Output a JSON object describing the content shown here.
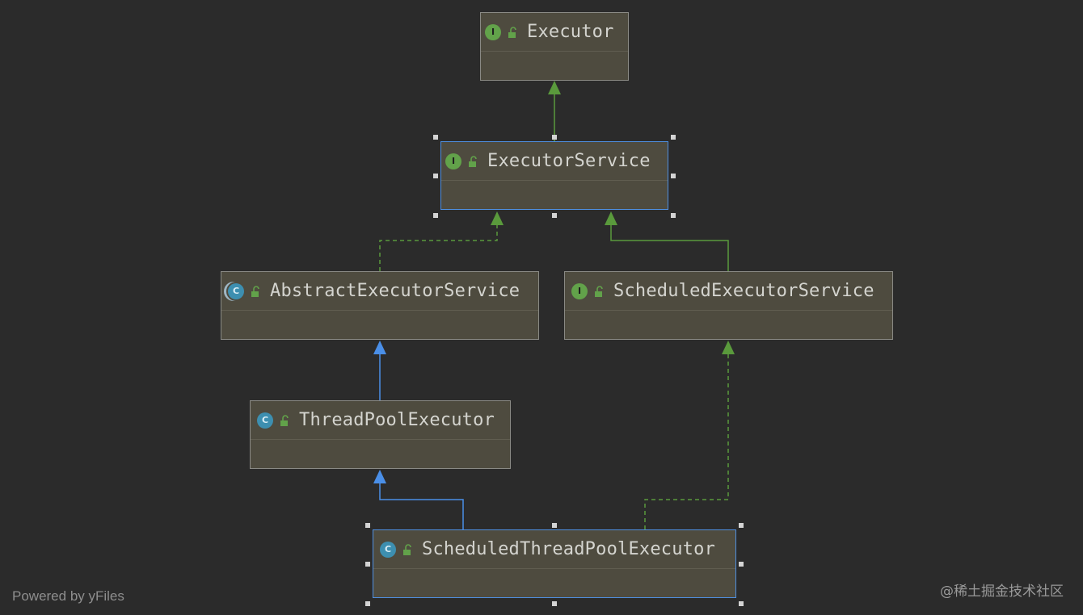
{
  "diagram": {
    "nodes": {
      "executor": {
        "name": "Executor",
        "kind": "interface",
        "badge": "I"
      },
      "executor_service": {
        "name": "ExecutorService",
        "kind": "interface",
        "badge": "I",
        "selected": true
      },
      "abstract_executor_service": {
        "name": "AbstractExecutorService",
        "kind": "abstract class",
        "badge": "C"
      },
      "scheduled_executor_service": {
        "name": "ScheduledExecutorService",
        "kind": "interface",
        "badge": "I"
      },
      "thread_pool_executor": {
        "name": "ThreadPoolExecutor",
        "kind": "class",
        "badge": "C"
      },
      "scheduled_thread_pool_executor": {
        "name": "ScheduledThreadPoolExecutor",
        "kind": "class",
        "badge": "C",
        "selected": true
      }
    },
    "edges": [
      {
        "from": "executor_service",
        "to": "executor",
        "type": "extends",
        "style": "solid",
        "color": "#5a9a3c"
      },
      {
        "from": "abstract_executor_service",
        "to": "executor_service",
        "type": "implements",
        "style": "dashed",
        "color": "#5a9a3c"
      },
      {
        "from": "scheduled_executor_service",
        "to": "executor_service",
        "type": "extends",
        "style": "solid",
        "color": "#5a9a3c"
      },
      {
        "from": "thread_pool_executor",
        "to": "abstract_executor_service",
        "type": "extends",
        "style": "solid",
        "color": "#4a8fe8"
      },
      {
        "from": "scheduled_thread_pool_executor",
        "to": "thread_pool_executor",
        "type": "extends",
        "style": "solid",
        "color": "#4a8fe8"
      },
      {
        "from": "scheduled_thread_pool_executor",
        "to": "scheduled_executor_service",
        "type": "implements",
        "style": "dashed",
        "color": "#5a9a3c"
      }
    ]
  },
  "footer": {
    "powered_by": "Powered by yFiles",
    "watermark": "@稀土掘金技术社区"
  },
  "colors": {
    "background": "#2b2b2b",
    "node_fill": "#4e4b3f",
    "interface_badge": "#62a24a",
    "class_badge": "#3d8fb0",
    "inheritance_blue": "#4a8fe8",
    "interface_green": "#5a9a3c",
    "selection_border": "#4f8fe0"
  }
}
